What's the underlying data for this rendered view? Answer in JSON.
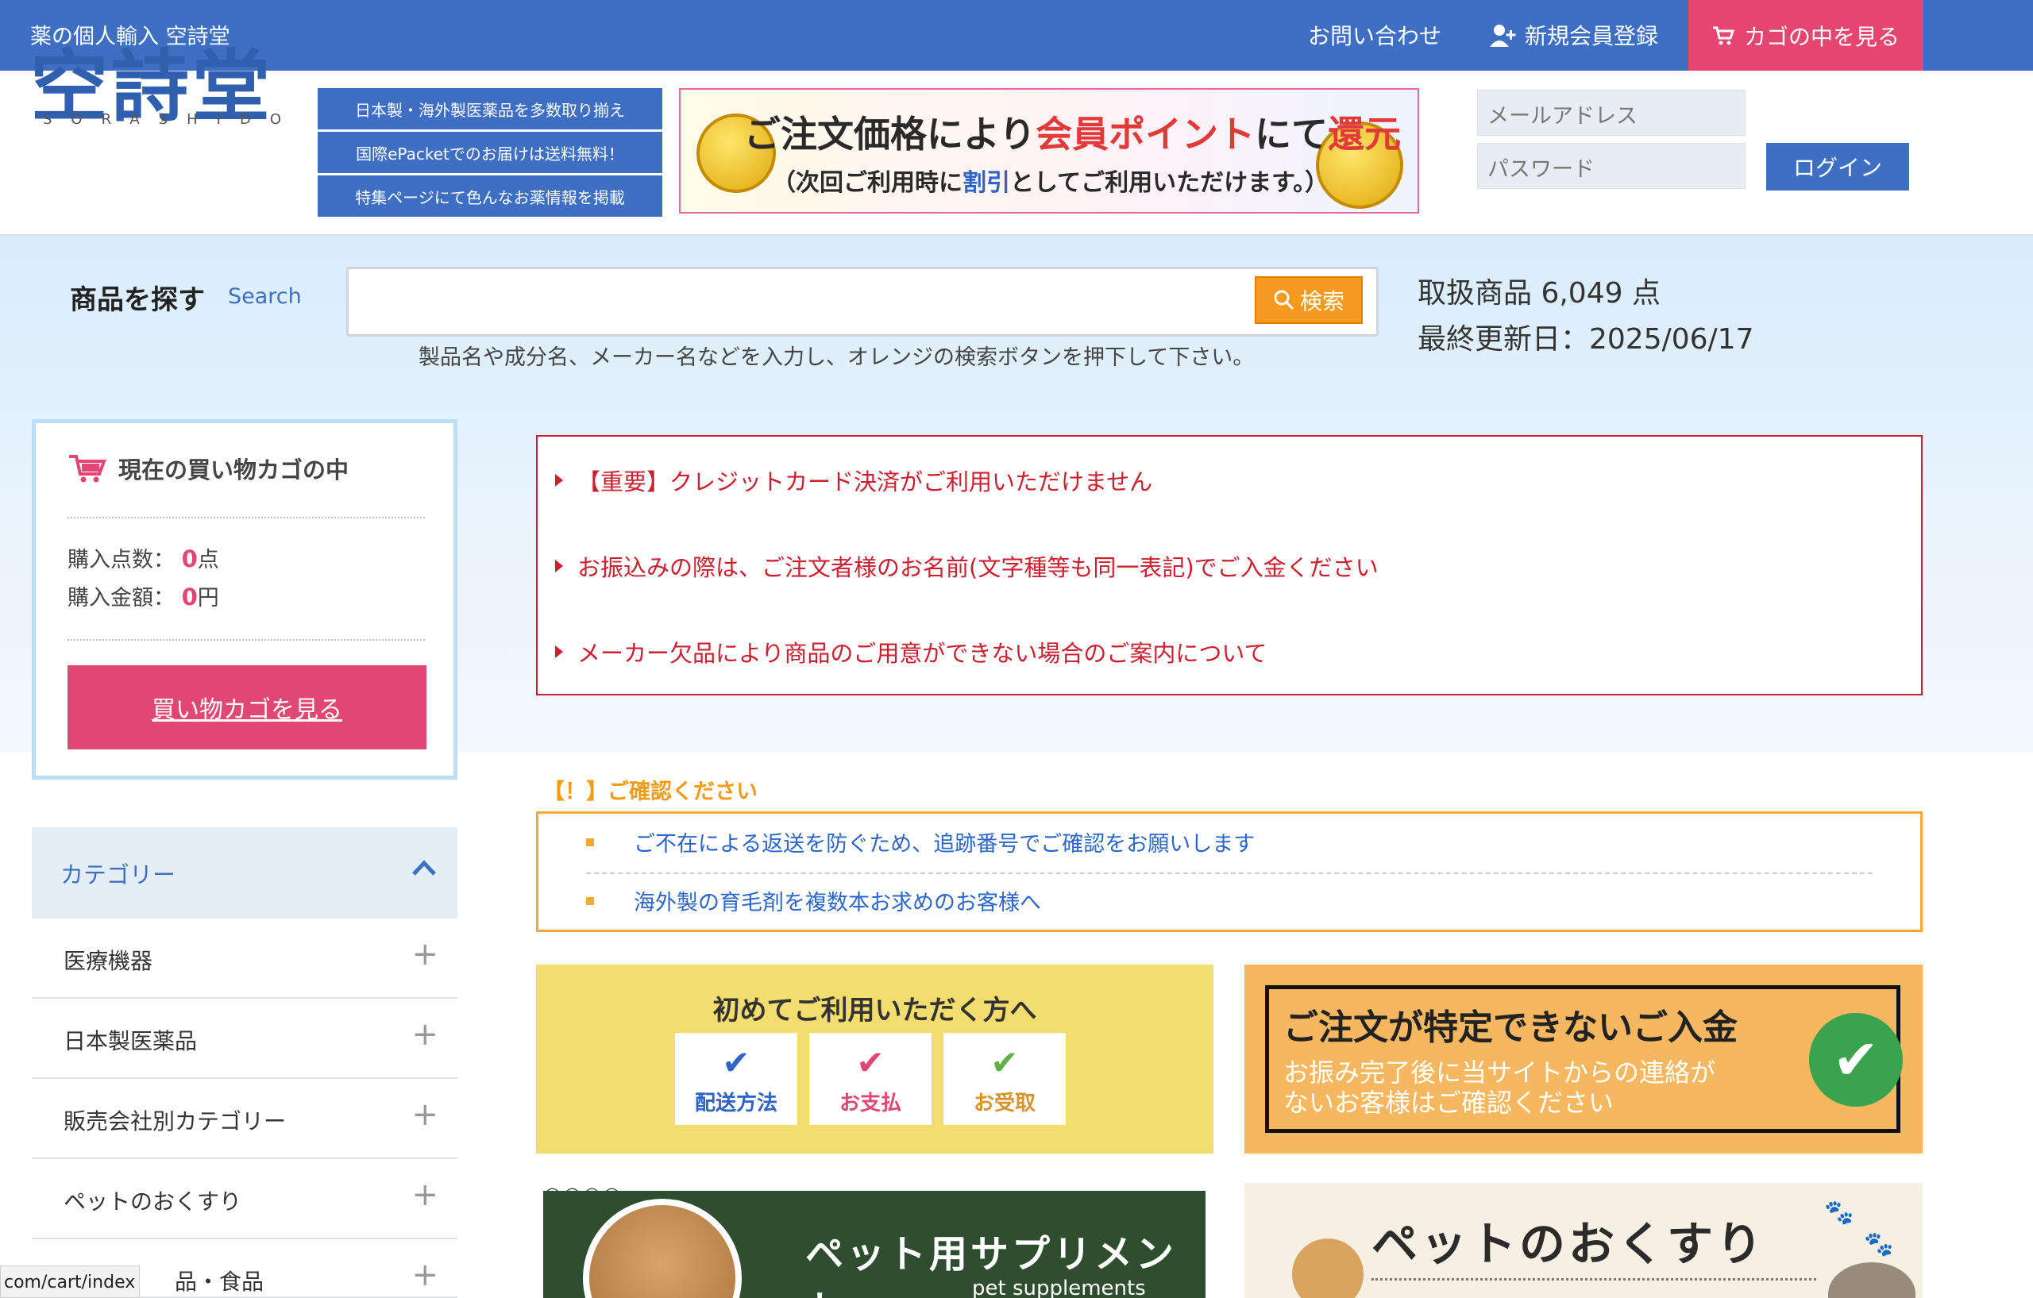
{
  "topbar": {
    "site_title": "薬の個人輸入 空詩堂",
    "contact": "お問い合わせ",
    "register": "新規会員登録",
    "cart": "カゴの中を見る"
  },
  "header": {
    "logo": "空詩堂",
    "logo_sub": "SORASHIDO",
    "taglines": [
      "日本製・海外製医薬品を多数取り揃え",
      "国際ePacketでのお届けは送料無料！",
      "特集ページにて色んなお薬情報を掲載"
    ],
    "banner": {
      "line1_a": "ご注文価格により",
      "line1_b": "会員ポイント",
      "line1_c": "にて",
      "line1_d": "還元",
      "line2_a": "（次回ご利用時に",
      "line2_b": "割引",
      "line2_c": "としてご利用いただけます。）"
    },
    "email_placeholder": "メールアドレス",
    "password_placeholder": "パスワード",
    "login": "ログイン"
  },
  "search": {
    "title": "商品を探す",
    "title_en": "Search",
    "button": "検索",
    "hint": "製品名や成分名、メーカー名などを入力し、オレンジの検索ボタンを押下して下さい。",
    "product_count": "取扱商品 6,049 点",
    "last_updated": "最終更新日：2025/06/17"
  },
  "cart_box": {
    "title": "現在の買い物カゴの中",
    "qty_label": "購入点数：",
    "qty_value": "0",
    "qty_unit": "点",
    "amount_label": "購入金額：",
    "amount_value": "0",
    "amount_unit": "円",
    "button": "買い物カゴを見る"
  },
  "categories": {
    "title": "カテゴリー",
    "items": [
      "医療機器",
      "日本製医薬品",
      "販売会社別カテゴリー",
      "ペットのおくすり",
      "品・食品"
    ]
  },
  "notices": [
    "【重要】クレジットカード決済がご利用いただけません",
    "お振込みの際は、ご注文者様のお名前(文字種等も同一表記)でご入金ください",
    "メーカー欠品により商品のご用意ができない場合のご案内について"
  ],
  "confirm": {
    "title": "【！】ご確認ください",
    "items": [
      "ご不在による返送を防ぐため、追跡番号でご確認をお願いします",
      "海外製の育毛剤を複数本お求めのお客様へ"
    ]
  },
  "tiles": {
    "first_time": {
      "title": "初めてご利用いただく方へ",
      "items": [
        "配送方法",
        "お支払",
        "お受取"
      ]
    },
    "unidentified": {
      "title": "ご注文が特定できないご入金",
      "line1": "お振み完了後に当サイトからの連絡が",
      "line2": "ないお客様はご確認ください"
    },
    "pet_supplements": {
      "title": "ペット用サプリメント",
      "sub": "pet supplements"
    },
    "pet_medicine": {
      "title": "ペットのおくすり"
    }
  },
  "status_url": "com/cart/index",
  "colors": {
    "primary": "#3f6fc2",
    "pink": "#e5466f",
    "orange": "#f59a1e",
    "red": "#cc1f2f"
  }
}
